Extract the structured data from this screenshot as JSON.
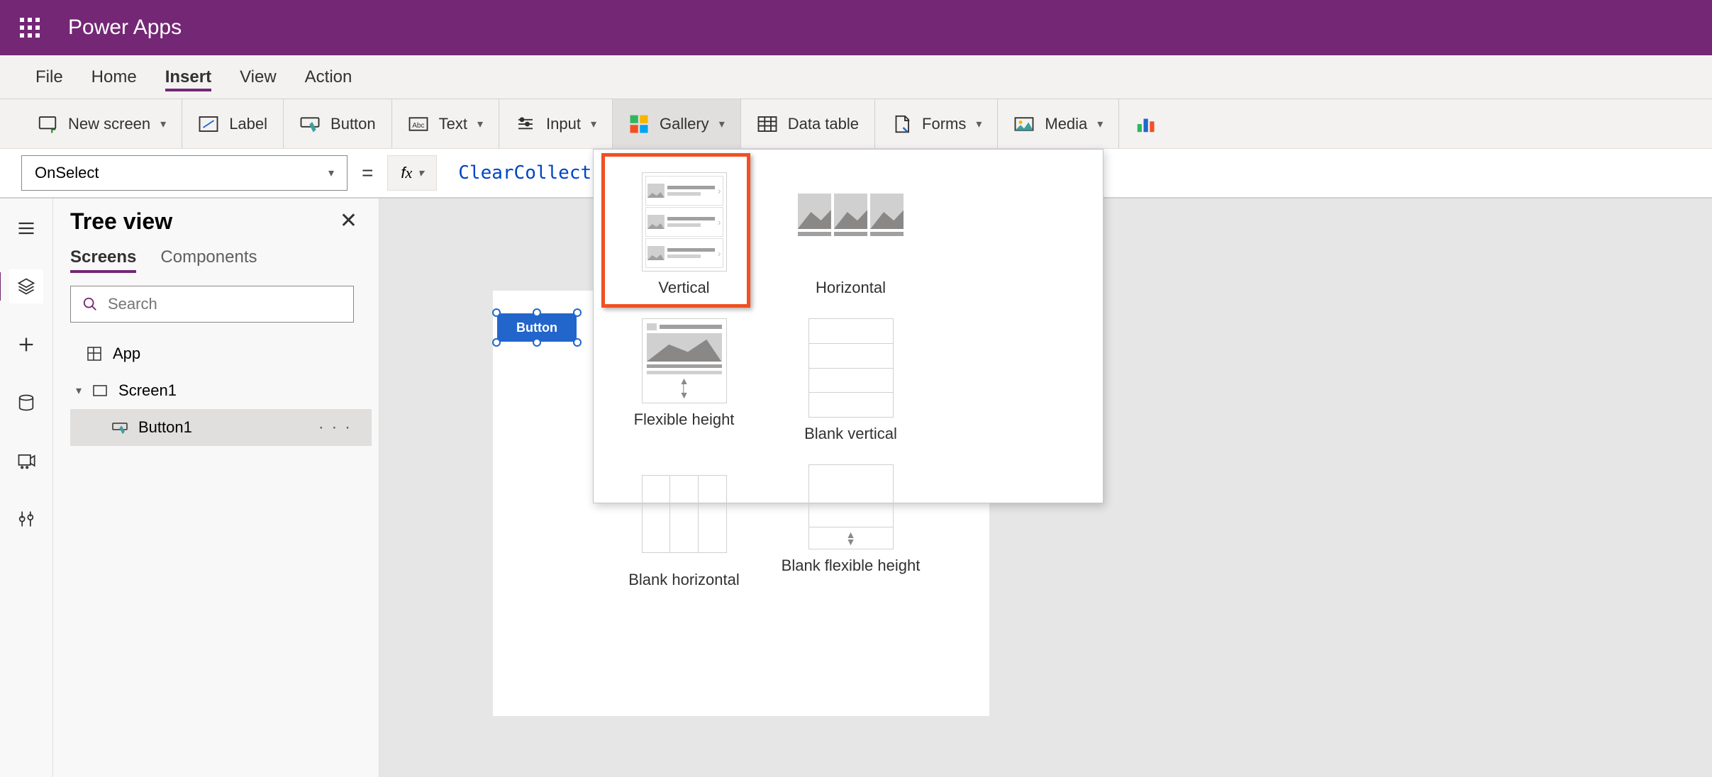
{
  "header": {
    "app_name": "Power Apps"
  },
  "menu": {
    "items": [
      "File",
      "Home",
      "Insert",
      "View",
      "Action"
    ],
    "active": "Insert"
  },
  "ribbon": {
    "new_screen": "New screen",
    "label": "Label",
    "button": "Button",
    "text": "Text",
    "input": "Input",
    "gallery": "Gallery",
    "data_table": "Data table",
    "forms": "Forms",
    "media": "Media"
  },
  "formula_bar": {
    "property": "OnSelect",
    "fx": "fx",
    "formula": "ClearCollect"
  },
  "tree_view": {
    "title": "Tree view",
    "tabs": [
      "Screens",
      "Components"
    ],
    "active_tab": "Screens",
    "search_placeholder": "Search",
    "app": "App",
    "screen1": "Screen1",
    "button1": "Button1"
  },
  "canvas": {
    "button_label": "Button"
  },
  "gallery_menu": {
    "vertical": "Vertical",
    "horizontal": "Horizontal",
    "flexible_height": "Flexible height",
    "blank_vertical": "Blank vertical",
    "blank_horizontal": "Blank horizontal",
    "blank_flexible_height": "Blank flexible height"
  }
}
